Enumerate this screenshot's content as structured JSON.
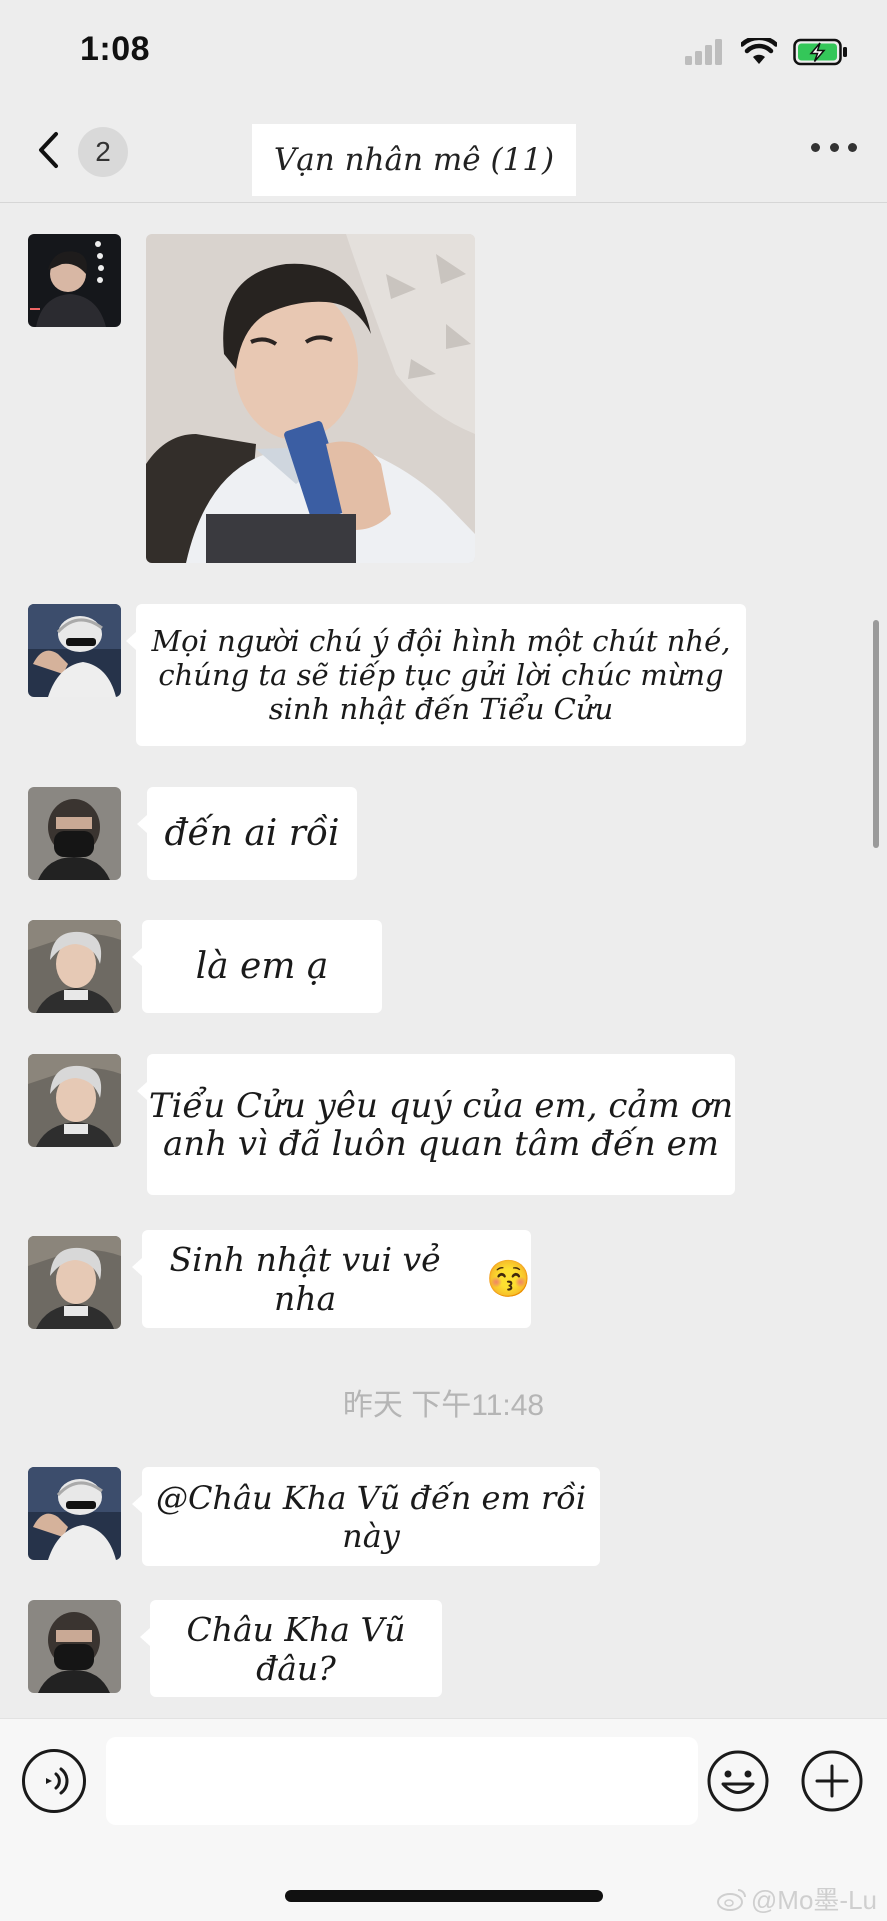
{
  "status_bar": {
    "time": "1:08"
  },
  "header": {
    "back_count": "2",
    "title": "Vạn nhân mê (11)"
  },
  "messages": [
    {
      "type": "image",
      "avatar": "member-a"
    },
    {
      "type": "text",
      "avatar": "member-b",
      "lines": [
        "Mọi người chú ý đội hình một chút nhé,",
        "chúng ta sẽ tiếp tục gửi lời chúc mừng",
        "sinh nhật đến Tiểu Cửu"
      ]
    },
    {
      "type": "text",
      "avatar": "member-c",
      "text": "đến ai rồi"
    },
    {
      "type": "text",
      "avatar": "member-d",
      "text": "là em ạ"
    },
    {
      "type": "text",
      "avatar": "member-d",
      "lines": [
        "Tiểu Cửu yêu quý của em, cảm ơn",
        "anh vì đã luôn quan tâm đến em"
      ]
    },
    {
      "type": "text",
      "avatar": "member-d",
      "text": "Sinh nhật vui vẻ nha",
      "emoji": "😚"
    },
    {
      "type": "text",
      "avatar": "member-b",
      "text": "@Châu Kha Vũ đến em rồi này"
    },
    {
      "type": "text",
      "avatar": "member-c",
      "text": "Châu Kha Vũ đâu?"
    }
  ],
  "timestamp": "昨天 下午11:48",
  "input_bar": {
    "placeholder": ""
  },
  "watermark": "@Mo墨-Lu",
  "icons": [
    "back-chevron-icon",
    "more-icon",
    "voice-icon",
    "emoji-icon",
    "plus-icon",
    "weibo-icon",
    "signal-icon",
    "wifi-icon",
    "battery-icon"
  ],
  "colors": {
    "background": "#ededed",
    "bubble": "#ffffff",
    "battery_fill": "#34c759"
  }
}
